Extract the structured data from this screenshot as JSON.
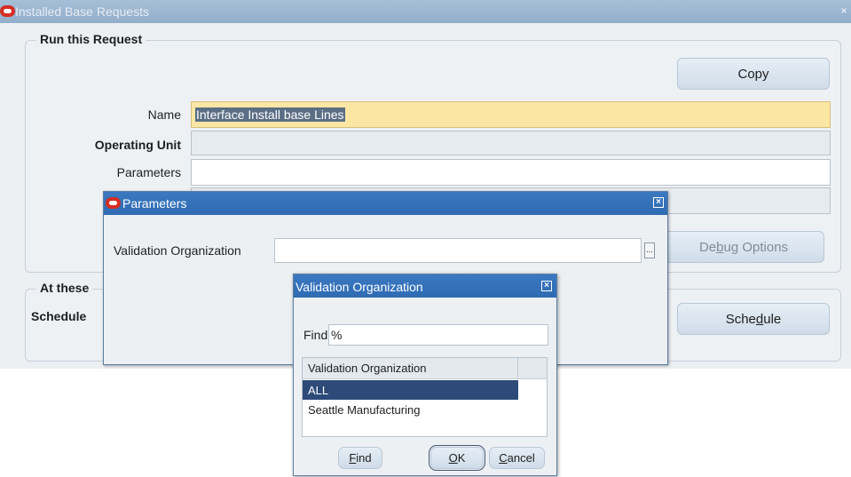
{
  "main_window": {
    "title": "Installed Base Requests",
    "close_glyph": "×"
  },
  "run_request": {
    "section_title": "Run this Request",
    "copy_button": "Copy",
    "name_label": "Name",
    "name_value": "Interface Install base Lines",
    "operating_unit_label": "Operating Unit",
    "operating_unit_value": "",
    "parameters_label": "Parameters",
    "parameters_value": "",
    "debug_button": {
      "pre": "De",
      "mnemonic": "b",
      "post": "ug Options"
    }
  },
  "schedule": {
    "section_title_partial": "At these",
    "schedule_label_partial": "Schedule",
    "schedule_button": {
      "pre": "Sche",
      "mnemonic": "d",
      "post": "ule"
    }
  },
  "parameters_dialog": {
    "title": "Parameters",
    "field_label": "Validation Organization",
    "field_value": "",
    "lov_glyph": "...",
    "close_glyph": "×"
  },
  "lov_dialog": {
    "title": "Validation Organization",
    "find_label": "Find",
    "find_value": "%",
    "column_header": "Validation Organization",
    "rows": [
      "ALL",
      "Seattle Manufacturing"
    ],
    "selected_index": 0,
    "close_glyph": "×",
    "find_button": {
      "mnemonic": "F",
      "post": "ind"
    },
    "ok_button": {
      "mnemonic": "O",
      "post": "K"
    },
    "cancel_button": {
      "mnemonic": "C",
      "post": "ancel"
    }
  },
  "colors": {
    "dialog_titlebar": "#2f6bb3",
    "main_titlebar": "#93aecb",
    "required_field": "#fbe6a4",
    "selected_row": "#2d4a78",
    "oracle_icon": "#d42e22"
  }
}
